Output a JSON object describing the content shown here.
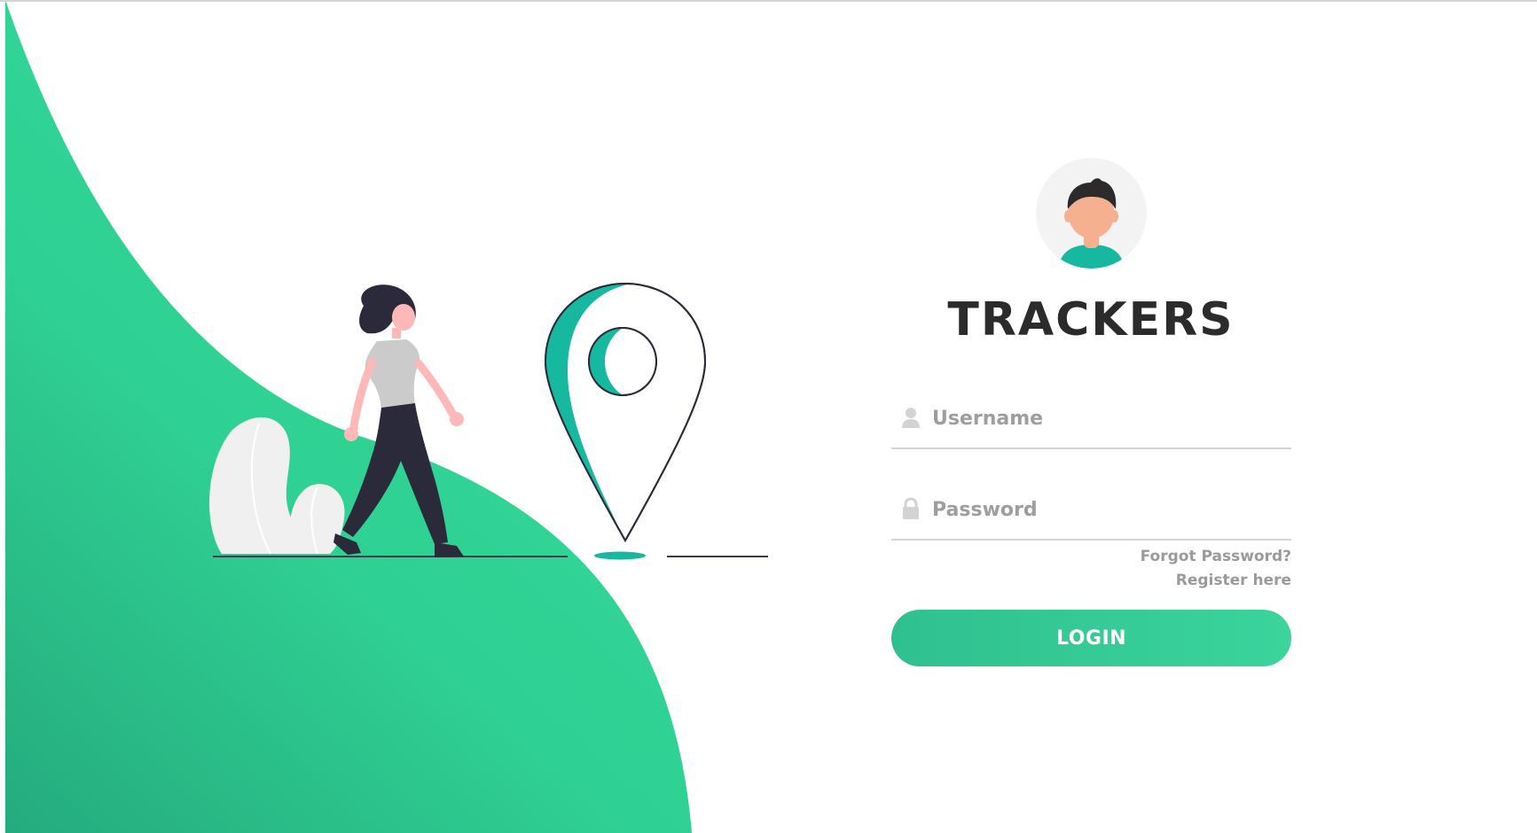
{
  "app": {
    "title": "TRACKERS"
  },
  "login_form": {
    "username": {
      "placeholder": "Username",
      "value": "",
      "icon": "user-icon"
    },
    "password": {
      "placeholder": "Password",
      "value": "",
      "icon": "lock-icon"
    },
    "forgot_password_label": "Forgot Password?",
    "register_label": "Register here",
    "login_button_label": "LOGIN"
  },
  "illustration": {
    "icons": [
      "woman-walking-illustration",
      "location-pin-icon",
      "plant-illustration",
      "avatar-icon"
    ]
  },
  "colors": {
    "accent_green": "#2fd093",
    "accent_green_dark": "#26a97a",
    "teal": "#17b8a0",
    "title_text": "#2b2b2b",
    "muted_text": "#9a9a9a",
    "underline": "#d5d5d5"
  }
}
